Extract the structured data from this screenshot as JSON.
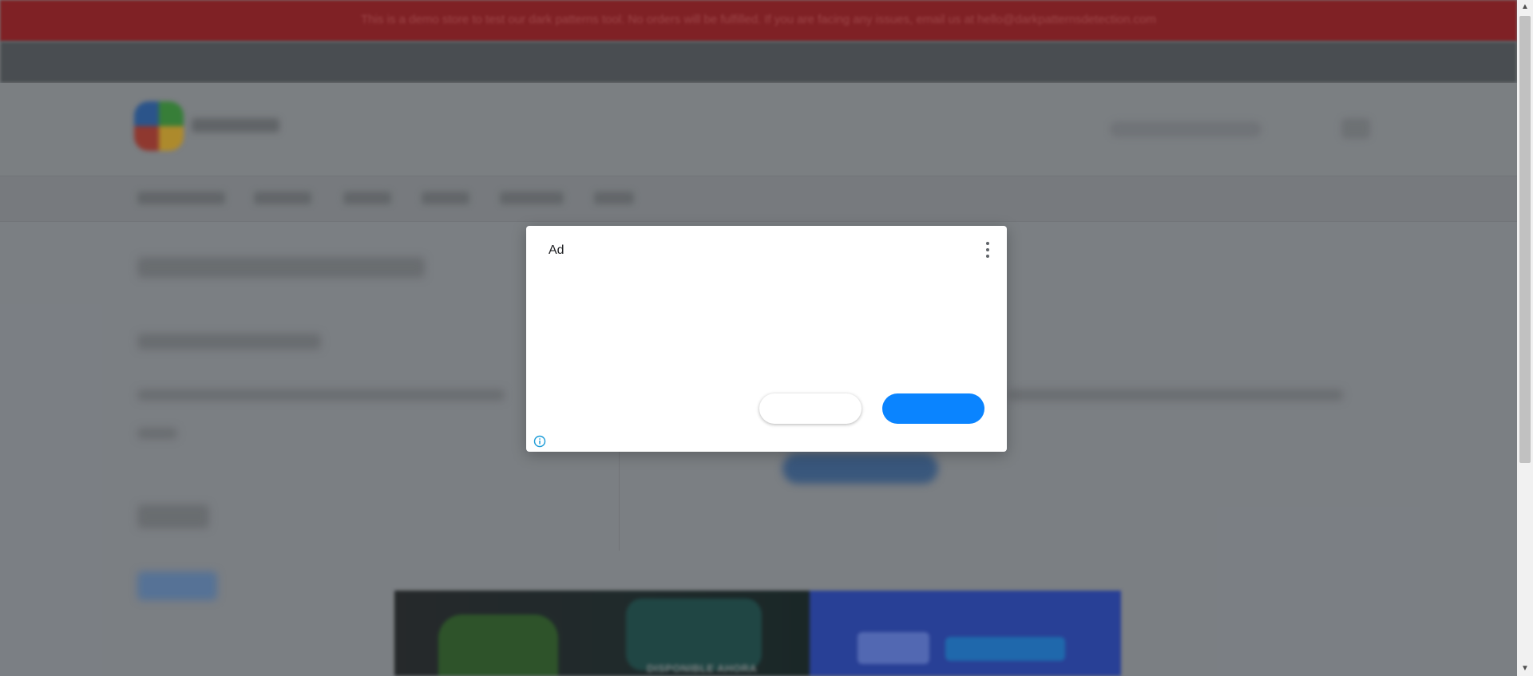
{
  "notice": {
    "text": "This is a demo store to test our dark patterns tool. No orders will be fulfilled. If you are facing any issues, email us at hello@darkpatternsdetection.com"
  },
  "banner": {
    "tag_text": "DISPONIBLE AHORA"
  },
  "ad_dialog": {
    "ad_label": "Ad",
    "more_options_icon": "more-vertical-icon",
    "secondary_button_label": "",
    "primary_button_label": "",
    "info_icon": "info-icon",
    "colors": {
      "primary_button": "#0a84ff",
      "info_icon": "#1a9bd7"
    }
  },
  "scrollbar": {
    "up_arrow": "▲",
    "down_arrow": "▼"
  },
  "colors": {
    "notice_bar": "#8f1f24",
    "overlay_page": "#8a8d92"
  }
}
